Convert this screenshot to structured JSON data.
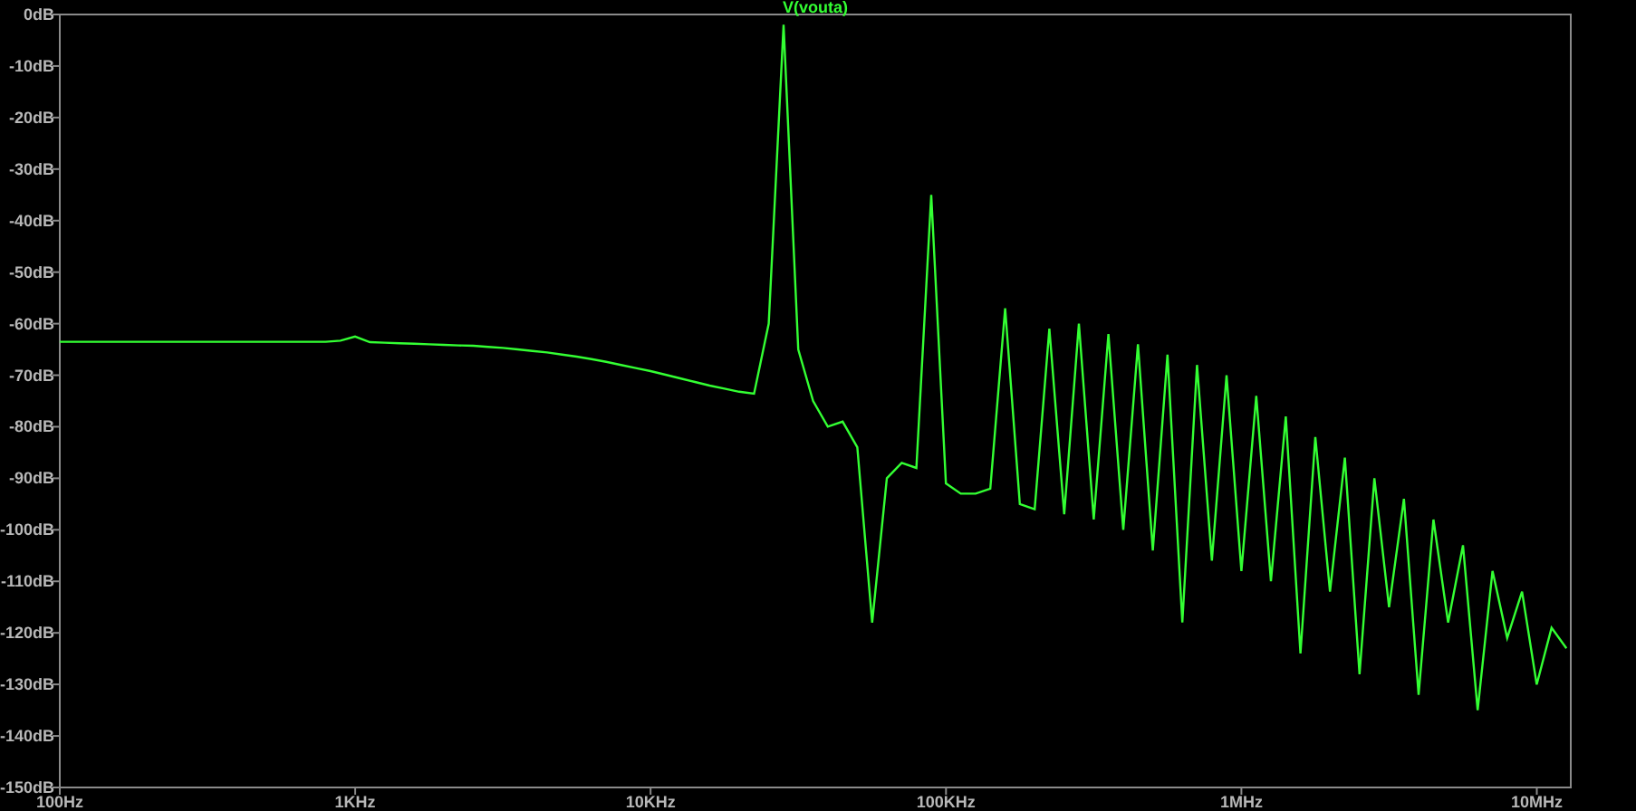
{
  "chart_data": {
    "type": "line",
    "categories": [
      "100Hz",
      null,
      null,
      null,
      null,
      null,
      null,
      null,
      null,
      null,
      null,
      null,
      null,
      null,
      null,
      null,
      null,
      null,
      null,
      null,
      "1KHz",
      null,
      null,
      null,
      null,
      null,
      null,
      null,
      null,
      null,
      null,
      null,
      null,
      null,
      null,
      null,
      null,
      null,
      null,
      null,
      "10KHz",
      null,
      null,
      null,
      null,
      null,
      null,
      null,
      null,
      null,
      null,
      null,
      null,
      null,
      null,
      null,
      null,
      null,
      null,
      null,
      "100KHz",
      null,
      null,
      null,
      null,
      null,
      null,
      null,
      null,
      null,
      null,
      null,
      null,
      null,
      null,
      null,
      null,
      null,
      null,
      null,
      "1MHz",
      null,
      null,
      null,
      null,
      null,
      null,
      null,
      null,
      null,
      null,
      null,
      null,
      null,
      null,
      null,
      null,
      null,
      null,
      null,
      "10MHz",
      null,
      null
    ],
    "ylim": [
      -150,
      0
    ],
    "yticks": [
      {
        "value": 0,
        "label": "0dB"
      },
      {
        "value": -10,
        "label": "-10dB"
      },
      {
        "value": -20,
        "label": "-20dB"
      },
      {
        "value": -30,
        "label": "-30dB"
      },
      {
        "value": -40,
        "label": "-40dB"
      },
      {
        "value": -50,
        "label": "-50dB"
      },
      {
        "value": -60,
        "label": "-60dB"
      },
      {
        "value": -70,
        "label": "-70dB"
      },
      {
        "value": -80,
        "label": "-80dB"
      },
      {
        "value": -90,
        "label": "-90dB"
      },
      {
        "value": -100,
        "label": "-100dB"
      },
      {
        "value": -110,
        "label": "-110dB"
      },
      {
        "value": -120,
        "label": "-120dB"
      },
      {
        "value": -130,
        "label": "-130dB"
      },
      {
        "value": -140,
        "label": "-140dB"
      },
      {
        "value": -150,
        "label": "-150dB"
      }
    ],
    "series": [
      {
        "name": "V(vouta)",
        "color": "#33ff33",
        "values": [
          -63.5,
          -63.5,
          -63.5,
          -63.5,
          -63.5,
          -63.5,
          -63.5,
          -63.5,
          -63.5,
          -63.5,
          -63.5,
          -63.5,
          -63.5,
          -63.5,
          -63.5,
          -63.5,
          -63.5,
          -63.5,
          -63.5,
          -63.3,
          -62.5,
          -63.6,
          -63.7,
          -63.8,
          -63.9,
          -64,
          -64.1,
          -64.2,
          -64.3,
          -64.5,
          -64.7,
          -65,
          -65.3,
          -65.6,
          -66,
          -66.4,
          -66.9,
          -67.4,
          -68,
          -68.6,
          -69.2,
          -69.9,
          -70.6,
          -71.3,
          -72,
          -72.6,
          -73.2,
          -73.6,
          -60,
          -2,
          -65,
          -75,
          -80,
          -79,
          -84,
          -118,
          -90,
          -87,
          -88,
          -35,
          -91,
          -93,
          -93,
          -92,
          -57,
          -95,
          -96,
          -61,
          -97,
          -60,
          -98,
          -62,
          -100,
          -64,
          -104,
          -66,
          -118,
          -68,
          -106,
          -70,
          -108,
          -74,
          -110,
          -78,
          -124,
          -82,
          -112,
          -86,
          -128,
          -90,
          -115,
          -94,
          -132,
          -98,
          -118,
          -103,
          -135,
          -108,
          -121,
          -112,
          -130,
          -119,
          -123
        ]
      }
    ]
  }
}
